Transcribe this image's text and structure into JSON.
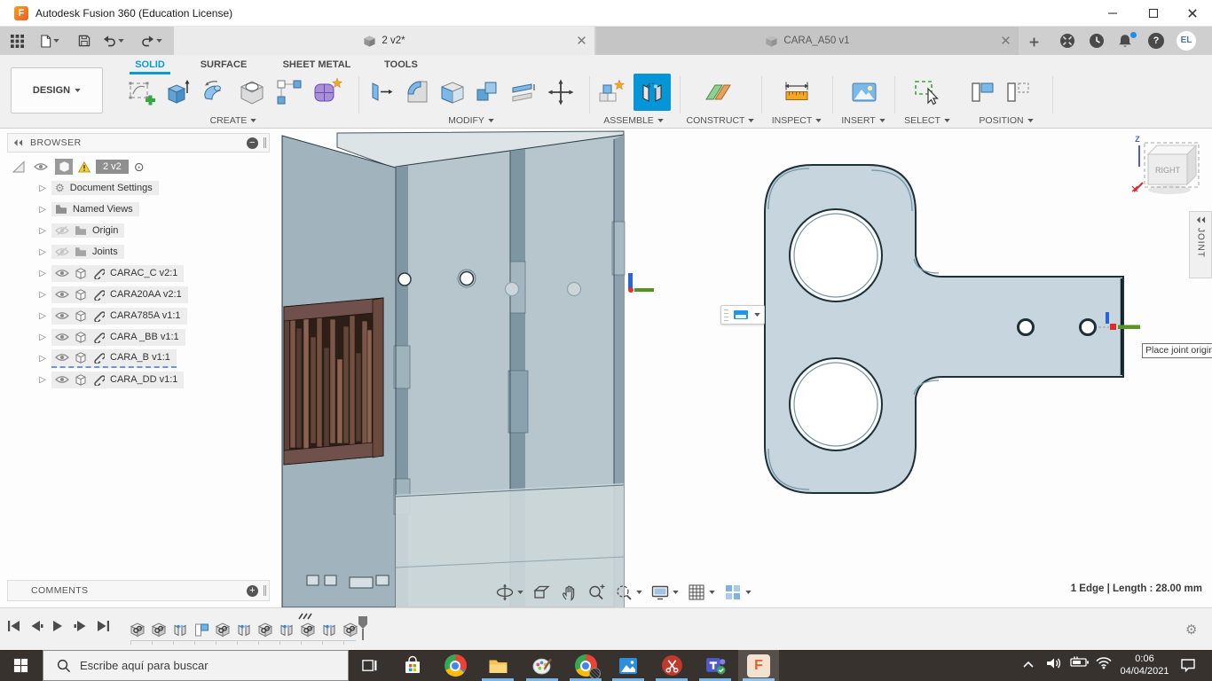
{
  "window": {
    "title": "Autodesk Fusion 360 (Education License)"
  },
  "documents": [
    {
      "label": "2 v2*"
    },
    {
      "label": "CARA_A50 v1"
    }
  ],
  "account": {
    "initials": "EL"
  },
  "workspace": {
    "label": "DESIGN"
  },
  "ribbon": {
    "tabs": [
      {
        "label": "SOLID",
        "active": true
      },
      {
        "label": "SURFACE"
      },
      {
        "label": "SHEET METAL"
      },
      {
        "label": "TOOLS"
      }
    ],
    "groups": [
      "CREATE",
      "MODIFY",
      "ASSEMBLE",
      "CONSTRUCT",
      "INSPECT",
      "INSERT",
      "SELECT",
      "POSITION"
    ],
    "active_tool": "Joint"
  },
  "browser": {
    "header": "BROWSER",
    "comments": "COMMENTS",
    "root": {
      "label": "2 v2"
    },
    "items": [
      {
        "label": "Document Settings"
      },
      {
        "label": "Named Views"
      },
      {
        "label": "Origin"
      },
      {
        "label": "Joints"
      },
      {
        "label": "CARAC_C v2:1"
      },
      {
        "label": "CARA20AA v2:1"
      },
      {
        "label": "CARA785A v1:1"
      },
      {
        "label": "CARA _BB v1:1"
      },
      {
        "label": "CARA_B v1:1"
      },
      {
        "label": "CARA_DD v1:1"
      }
    ]
  },
  "viewport": {
    "viewcube_face": "RIGHT",
    "viewcube_axis_z": "Z",
    "joint_panel": "JOINT",
    "tooltip": "Place joint origin",
    "status": "1 Edge | Length : 28.00 mm"
  },
  "timeline": {
    "items": [
      "link",
      "link",
      "joint",
      "flag",
      "link",
      "joint",
      "link",
      "joint",
      "link-edited",
      "joint",
      "link"
    ]
  },
  "taskbar": {
    "search_placeholder": "Escribe aquí para buscar",
    "clock": {
      "time": "0:06",
      "date": "04/04/2021"
    }
  },
  "icons": {
    "expand": "▷",
    "gear": "⚙",
    "target": "⊙",
    "minus": "−",
    "plus": "+",
    "question": "?",
    "fusion_f": "F"
  },
  "colors": {
    "accent": "#0696d7",
    "warning": "#f7d02e",
    "taskbar_bg": "#38322e"
  }
}
